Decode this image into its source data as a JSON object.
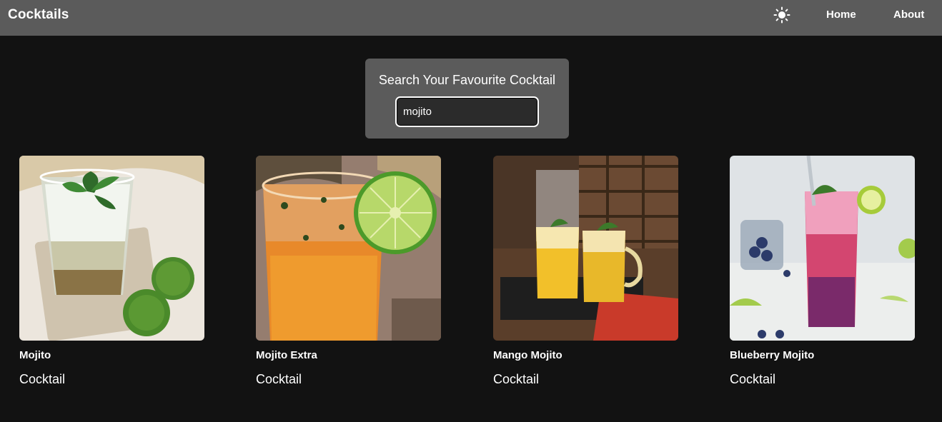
{
  "header": {
    "brand": "Cocktails",
    "theme_icon": "sun-icon",
    "nav": {
      "home": "Home",
      "about": "About"
    }
  },
  "search": {
    "title": "Search Your Favourite Cocktail",
    "value": "mojito"
  },
  "cocktails": [
    {
      "name": "Mojito",
      "type": "Cocktail"
    },
    {
      "name": "Mojito Extra",
      "type": "Cocktail"
    },
    {
      "name": "Mango Mojito",
      "type": "Cocktail"
    },
    {
      "name": "Blueberry Mojito",
      "type": "Cocktail"
    }
  ],
  "colors": {
    "background": "#121212",
    "navbar": "#5b5b5b",
    "search_card": "#5b5b5b",
    "text": "#ffffff"
  }
}
